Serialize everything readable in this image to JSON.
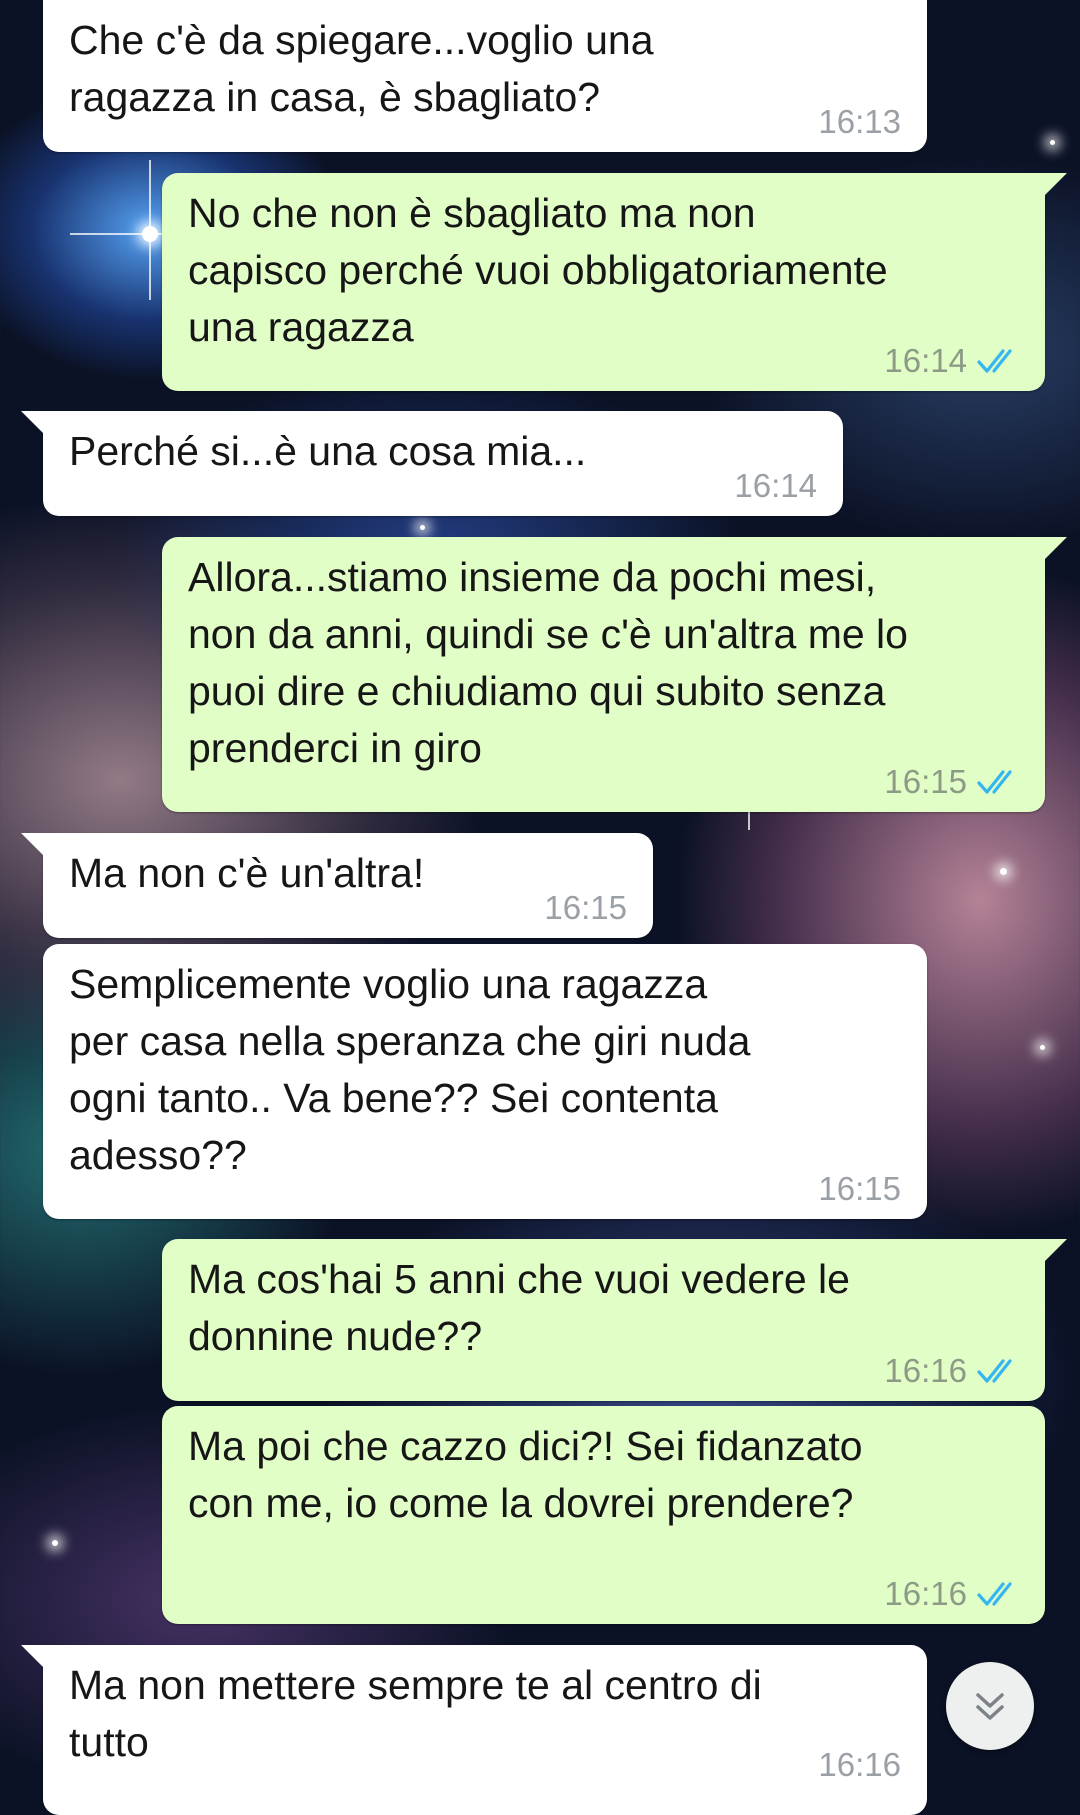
{
  "conversation": {
    "messages": [
      {
        "direction": "incoming",
        "text": "Che c'è da spiegare...voglio una\nragazza in casa, è sbagliato?",
        "time": "16:13"
      },
      {
        "direction": "outgoing",
        "text": "No che non è sbagliato ma non\ncapisco perché vuoi obbligatoriamente\nuna ragazza",
        "time": "16:14",
        "status": "read"
      },
      {
        "direction": "incoming",
        "text": "Perché si...è una cosa mia...",
        "time": "16:14"
      },
      {
        "direction": "outgoing",
        "text": "Allora...stiamo insieme da pochi mesi,\nnon da anni, quindi se c'è un'altra me lo\npuoi dire e chiudiamo qui subito senza\nprenderci in giro",
        "time": "16:15",
        "status": "read"
      },
      {
        "direction": "incoming",
        "text": "Ma non c'è un'altra!",
        "time": "16:15"
      },
      {
        "direction": "incoming",
        "text": "Semplicemente voglio una ragazza\nper casa nella speranza che giri nuda\nogni tanto.. Va bene?? Sei contenta\nadesso??",
        "time": "16:15"
      },
      {
        "direction": "outgoing",
        "text": "Ma cos'hai 5 anni che vuoi vedere le\ndonnine nude??",
        "time": "16:16",
        "status": "read"
      },
      {
        "direction": "outgoing",
        "text": "Ma poi che cazzo dici?! Sei fidanzato\ncon me, io come la dovrei prendere?",
        "time": "16:16",
        "status": "read"
      },
      {
        "direction": "incoming",
        "text": "Ma non mettere sempre te al centro di\ntutto",
        "time": "16:16"
      }
    ]
  },
  "icons": {
    "read_receipt": "double-check-icon",
    "scroll_down": "chevron-double-down-icon"
  },
  "colors": {
    "incoming_bubble": "#ffffff",
    "outgoing_bubble": "#e1fec6",
    "read_ticks": "#34b7f1",
    "timestamp": "#9aa0a6"
  }
}
